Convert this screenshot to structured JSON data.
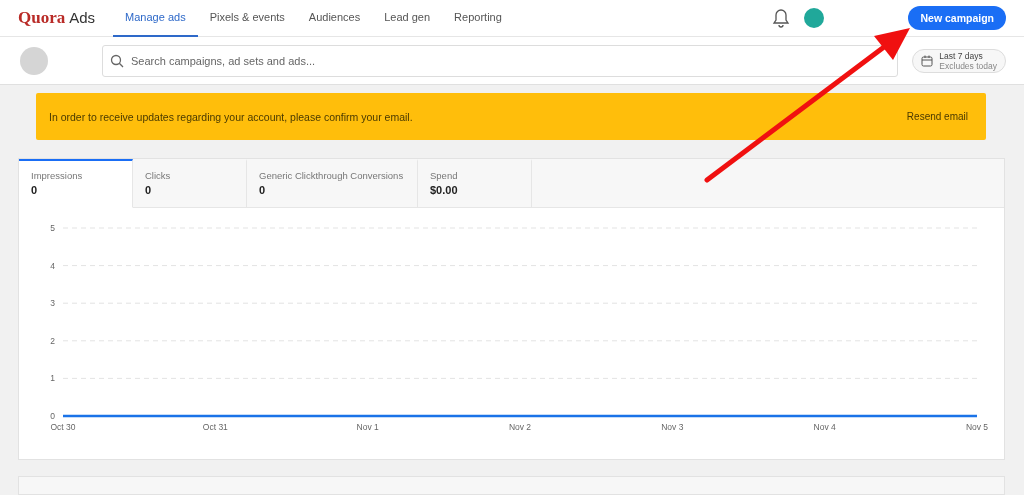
{
  "header": {
    "logo_brand": "Quora",
    "logo_product": "Ads",
    "nav": [
      {
        "label": "Manage ads",
        "selected": true
      },
      {
        "label": "Pixels & events",
        "selected": false
      },
      {
        "label": "Audiences",
        "selected": false
      },
      {
        "label": "Lead gen",
        "selected": false
      },
      {
        "label": "Reporting",
        "selected": false
      }
    ],
    "primary_button": "New campaign"
  },
  "toolbar": {
    "search": {
      "placeholder": "Search campaigns, ad sets and ads..."
    },
    "date_range": {
      "label": "Last 7 days",
      "note": "Excludes today"
    }
  },
  "banner": {
    "message": "In order to receive updates regarding your account, please confirm your email.",
    "action": "Resend email"
  },
  "metrics": {
    "tabs": [
      {
        "label": "Impressions",
        "value": "0",
        "selected": true
      },
      {
        "label": "Clicks",
        "value": "0",
        "selected": false
      },
      {
        "label": "Generic Clickthrough Conversions",
        "value": "0",
        "selected": false
      },
      {
        "label": "Spend",
        "value": "$0.00",
        "selected": false
      }
    ],
    "chart_data": {
      "type": "line",
      "categories": [
        "Oct 30",
        "Oct 31",
        "Nov 1",
        "Nov 2",
        "Nov 3",
        "Nov 4",
        "Nov 5"
      ],
      "series": [
        {
          "color": "#1a73e8",
          "values": [
            0,
            0,
            0,
            0,
            0,
            0,
            0
          ]
        }
      ],
      "grid": true,
      "ylim": [
        0,
        5
      ],
      "yticks": [
        0,
        1,
        2,
        3,
        4,
        5
      ]
    }
  }
}
